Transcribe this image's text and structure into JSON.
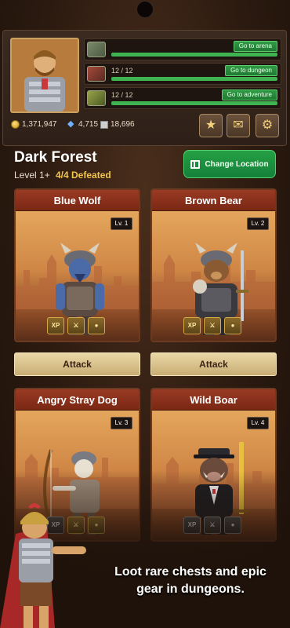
{
  "currency": {
    "gold": "1,371,947",
    "gems": "4,715",
    "shards": "18,696"
  },
  "activities": [
    {
      "count": "",
      "button": "Go to arena",
      "progress": 1.0
    },
    {
      "count": "12 / 12",
      "button": "Go to dungeon",
      "progress": 1.0
    },
    {
      "count": "12 / 12",
      "button": "Go to adventure",
      "progress": 1.0
    }
  ],
  "dungeon": {
    "title": "Dark Forest",
    "level": "Level 1+",
    "defeated": "4/4 Defeated",
    "change_location": "Change Location"
  },
  "enemies": [
    {
      "name": "Blue Wolf",
      "level": "Lv. 1",
      "attack": "Attack"
    },
    {
      "name": "Brown Bear",
      "level": "Lv. 2",
      "attack": "Attack"
    },
    {
      "name": "Angry Stray Dog",
      "level": "Lv. 3"
    },
    {
      "name": "Wild Boar",
      "level": "Lv. 4"
    }
  ],
  "reward_badges": {
    "xp": "XP"
  },
  "promo": {
    "line1": "Loot rare chests and epic",
    "line2": "gear in dungeons."
  },
  "icons": {
    "star": "star-icon",
    "mail": "mail-icon",
    "settings": "gear-icon",
    "map": "map-icon"
  },
  "colors": {
    "accent_green": "#1f8a3a",
    "card_header": "#8a3220",
    "gold_text": "#f2c64a",
    "attack_button": "#d9c28d"
  }
}
